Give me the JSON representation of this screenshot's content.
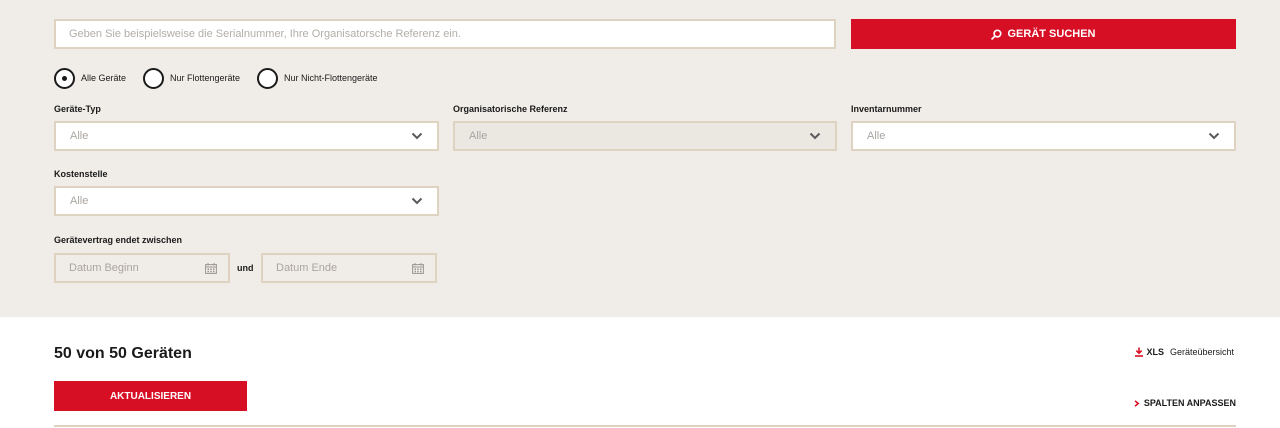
{
  "search": {
    "placeholder": "Geben Sie beispielsweise die Serialnummer, Ihre Organisatorsche Referenz ein.",
    "value": "",
    "button_label": "GERÄT SUCHEN",
    "button_icon": "search-icon"
  },
  "device_filter": {
    "options": [
      {
        "label": "Alle Geräte",
        "selected": true
      },
      {
        "label": "Nur Flottengeräte",
        "selected": false
      },
      {
        "label": "Nur Nicht-Flottengeräte",
        "selected": false
      }
    ]
  },
  "filters": {
    "device_type": {
      "label": "Geräte-Typ",
      "value": "Alle"
    },
    "org_reference": {
      "label": "Organisatorische Referenz",
      "value": "Alle",
      "disabled": true
    },
    "inventory_number": {
      "label": "Inventarnummer",
      "value": "Alle"
    },
    "cost_center": {
      "label": "Kostenstelle",
      "value": "Alle"
    }
  },
  "contract_end": {
    "label": "Gerätevertrag endet zwischen",
    "start_placeholder": "Datum Beginn",
    "separator": "und",
    "end_placeholder": "Datum Ende",
    "icon": "calendar-icon"
  },
  "results": {
    "count_text": "50 von 50 Geräten",
    "refresh_label": "AKTUALISIEREN",
    "export": {
      "format": "XLS",
      "description": "Geräteübersicht",
      "icon": "download-icon"
    },
    "columns_label": "SPALTEN ANPASSEN",
    "columns_icon": "chevron-right-icon"
  },
  "colors": {
    "accent": "#d70f25",
    "panel_bg": "#f0ede8",
    "field_border": "#ddd3c0",
    "placeholder_text": "#a9a4a0"
  }
}
